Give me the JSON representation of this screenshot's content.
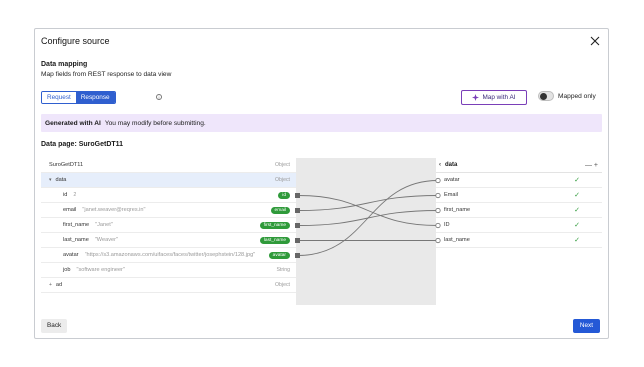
{
  "dialog": {
    "title": "Configure source",
    "section_title": "Data mapping",
    "section_subtitle": "Map fields from REST response to data view",
    "tabs": [
      {
        "label": "Request",
        "active": false
      },
      {
        "label": "Response",
        "active": true
      }
    ],
    "map_ai_label": "Map with AI",
    "mapped_only_label": "Mapped only",
    "mapped_only_on": false,
    "banner": {
      "bold": "Generated with AI",
      "text": "You may modify before submitting."
    },
    "page_title": "Data page: SuroGetDT11"
  },
  "left_tree": {
    "root": {
      "name": "SuroGetDT11",
      "type": "Object"
    },
    "data_node": {
      "name": "data",
      "type": "Object"
    },
    "fields": [
      {
        "name": "id",
        "sample": "2",
        "mapped_to": "id",
        "mapped": true
      },
      {
        "name": "email",
        "sample": "\"janet.weaver@reqres.in\"",
        "mapped_to": "email",
        "mapped": true
      },
      {
        "name": "first_name",
        "sample": "\"Janet\"",
        "mapped_to": "first_name",
        "mapped": true
      },
      {
        "name": "last_name",
        "sample": "\"Weaver\"",
        "mapped_to": "last_name",
        "mapped": true
      },
      {
        "name": "avatar",
        "sample": "\"https://s3.amazonaws.com/uifaces/faces/twitter/josephstein/128.jpg\"",
        "mapped_to": "avatar",
        "mapped": true
      },
      {
        "name": "job",
        "sample": "\"software engineer\"",
        "type": "String",
        "mapped": false
      }
    ],
    "ad_node": {
      "name": "ad",
      "type": "Object"
    }
  },
  "right_tree": {
    "header": "data",
    "fields": [
      "avatar",
      "Email",
      "first_name",
      "ID",
      "last_name"
    ]
  },
  "links": [
    {
      "from": 4,
      "to": 0
    },
    {
      "from": 1,
      "to": 1
    },
    {
      "from": 2,
      "to": 2
    },
    {
      "from": 0,
      "to": 3
    },
    {
      "from": 3,
      "to": 4
    }
  ],
  "footer": {
    "back_label": "Back",
    "next_label": "Next"
  },
  "colors": {
    "accent": "#2459d6",
    "ai_purple": "#7a3fb8",
    "banner_bg": "#efe6fb",
    "mapped_green": "#2f9a3a"
  }
}
